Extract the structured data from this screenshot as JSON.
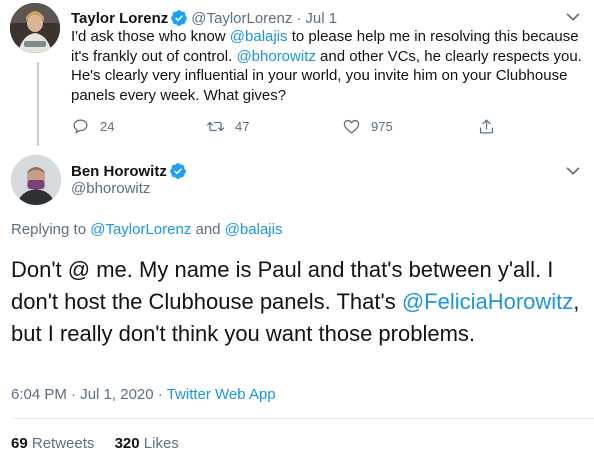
{
  "parent_tweet": {
    "name": "Taylor Lorenz",
    "handle": "@TaylorLorenz",
    "separator": "·",
    "date": "Jul 1",
    "text_segments": [
      {
        "text": "I'd ask those who know ",
        "type": "text"
      },
      {
        "text": "@balajis",
        "type": "mention"
      },
      {
        "text": " to please help me in resolving this because it's frankly out of control. ",
        "type": "text"
      },
      {
        "text": "@bhorowitz",
        "type": "mention"
      },
      {
        "text": " and other VCs, he clearly respects you. He's clearly very influential in your world, you invite him on your Clubhouse panels every week. What gives?",
        "type": "text"
      }
    ],
    "actions": {
      "reply": {
        "icon": "reply-icon",
        "count": "24"
      },
      "retweet": {
        "icon": "retweet-icon",
        "count": "47"
      },
      "like": {
        "icon": "like-icon",
        "count": "975"
      },
      "share": {
        "icon": "share-icon"
      }
    }
  },
  "main_tweet": {
    "name": "Ben Horowitz",
    "handle": "@bhorowitz",
    "replying_to": {
      "prefix": "Replying to ",
      "user1": "@TaylorLorenz",
      "and": " and ",
      "user2": "@balajis"
    },
    "text_segments": [
      {
        "text": "Don't @ me. My name is Paul and that's between y'all. I don't host the Clubhouse panels. That's ",
        "type": "text"
      },
      {
        "text": "@FeliciaHorowitz",
        "type": "mention"
      },
      {
        "text": ", but I really don't think you want those problems.",
        "type": "text"
      }
    ],
    "time": "6:04 PM",
    "separator": "·",
    "full_date": "Jul 1, 2020",
    "source": "Twitter Web App",
    "retweets_count": "69",
    "retweets_label": "Retweets",
    "likes_count": "320",
    "likes_label": "Likes"
  },
  "colors": {
    "link": "#1b95e0",
    "muted": "#5b7083",
    "text": "#0f1419",
    "verified": "#1da1f2",
    "thread_line": "#c4cfd6"
  }
}
